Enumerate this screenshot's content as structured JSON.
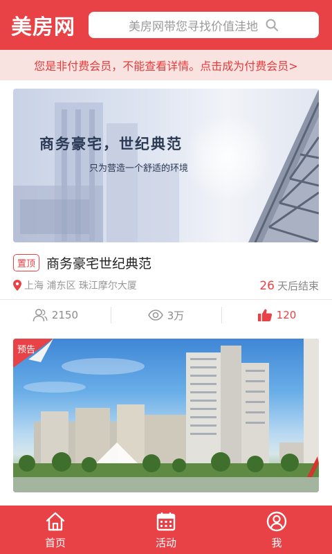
{
  "header": {
    "logo": "美房网",
    "search_placeholder": "美房网带您寻找价值洼地"
  },
  "notice": {
    "text": "您是非付费会员，不能查看详情。点击成为付费会员>"
  },
  "listings": [
    {
      "image_headline": "商务豪宅，世纪典范",
      "image_subline": "只为营造一个舒适的环境",
      "tag": "置顶",
      "title": "商务豪宅世纪典范",
      "location": "上海 浦东区 珠江摩尔大厦",
      "days_num": "26",
      "days_text": "天后结束",
      "participants": "2150",
      "views": "3万",
      "likes": "120"
    },
    {
      "badge": "预告"
    }
  ],
  "bottom_nav": [
    {
      "label": "首页",
      "icon": "home-icon"
    },
    {
      "label": "活动",
      "icon": "calendar-icon"
    },
    {
      "label": "我",
      "icon": "user-icon"
    }
  ],
  "colors": {
    "brand": "#e84246",
    "notice_bg": "#f9e3e1",
    "muted": "#999999"
  }
}
